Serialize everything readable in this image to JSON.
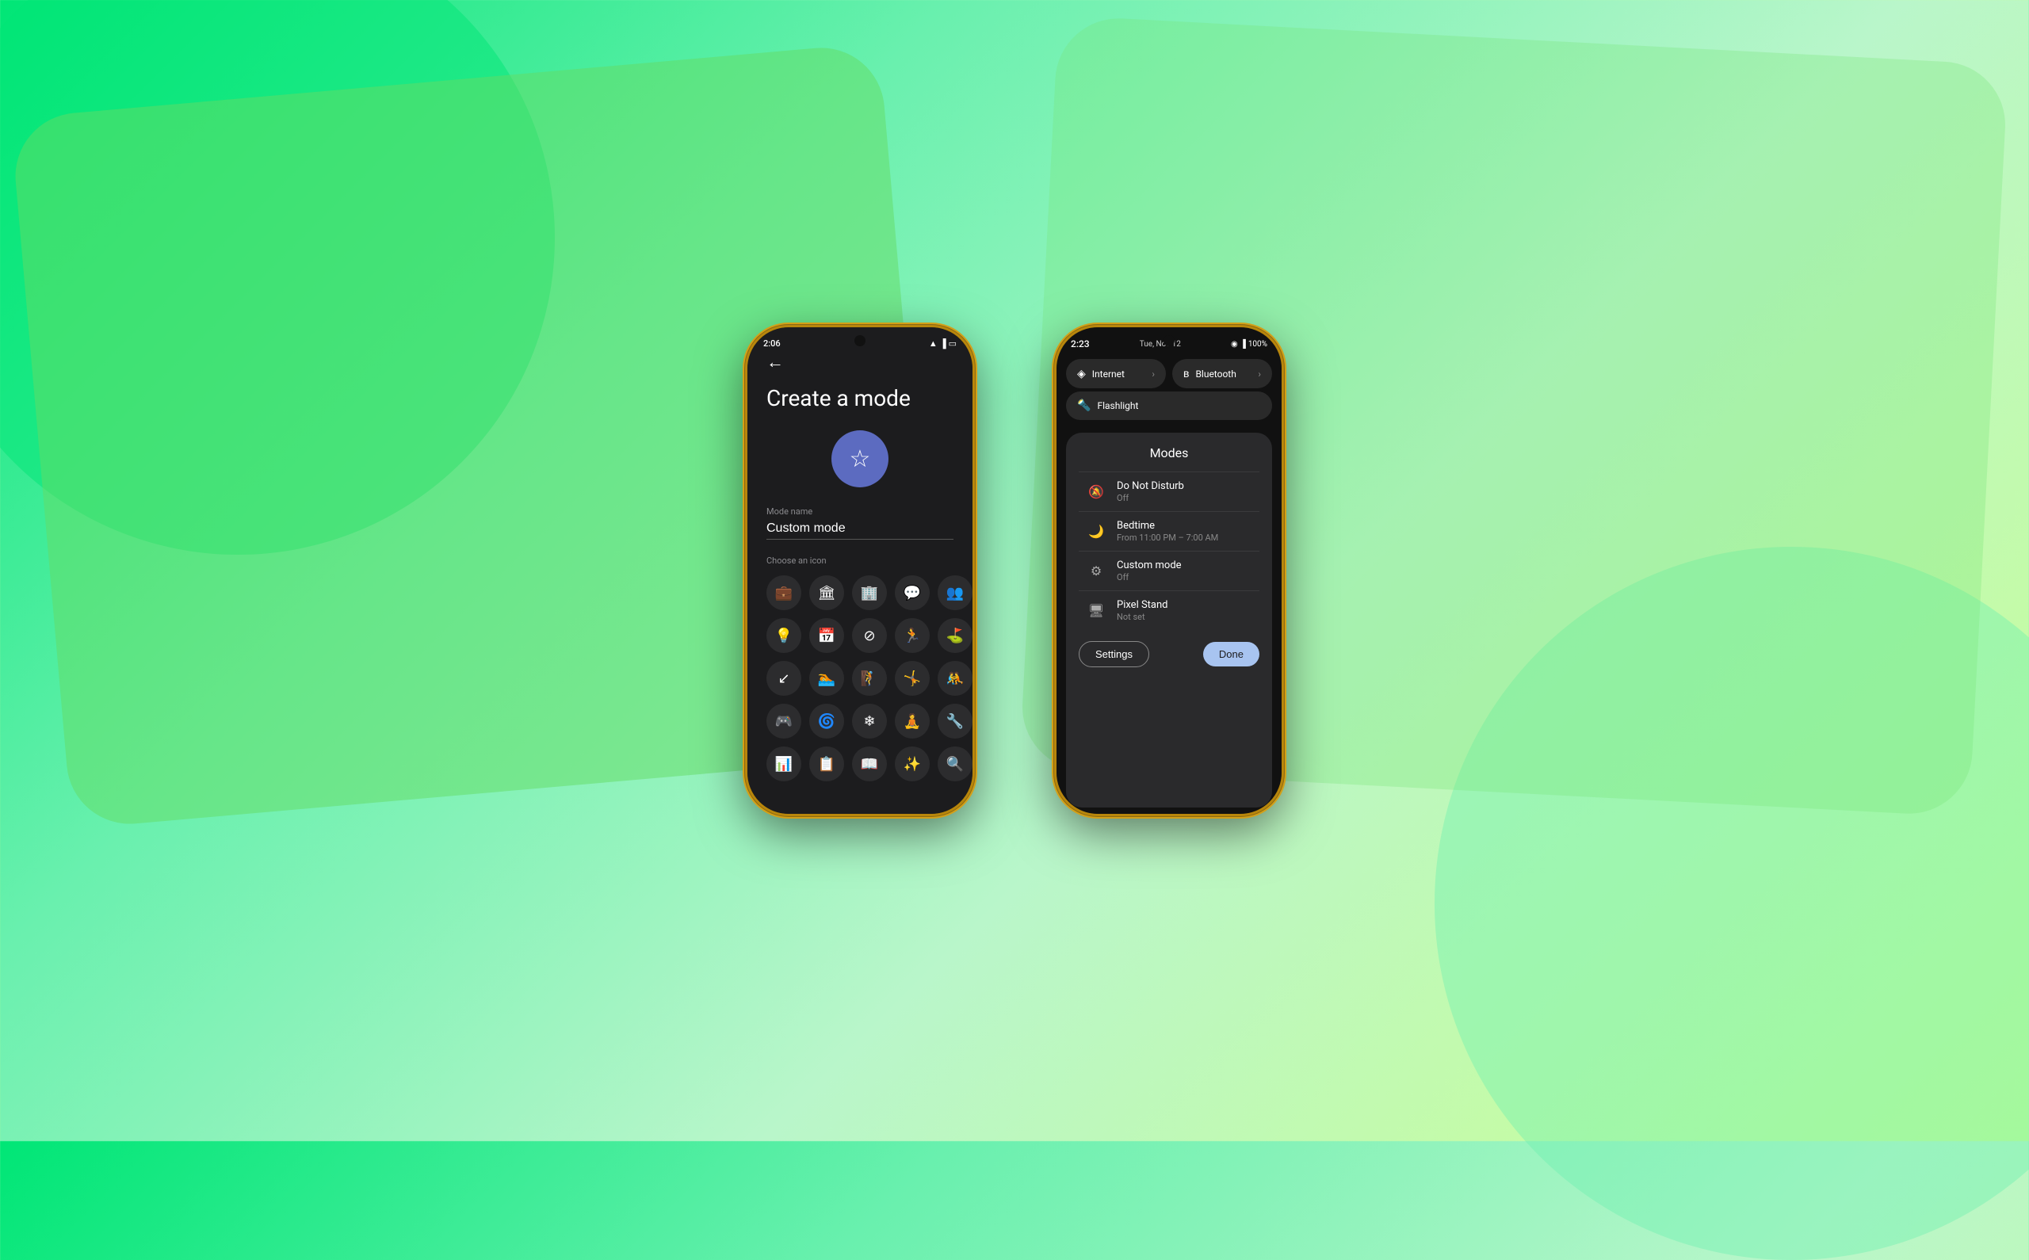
{
  "background": {
    "color1": "#00e676",
    "color2": "#69f0ae"
  },
  "phone1": {
    "statusBar": {
      "time": "2:06",
      "icons": [
        "wifi",
        "signal",
        "battery"
      ]
    },
    "title": "Create a mode",
    "iconLabel": "Mode name",
    "modeNameValue": "Custom mode",
    "modeNamePlaceholder": "Custom mode",
    "chooseIconLabel": "Choose an icon",
    "icons": [
      "💼",
      "🏛",
      "🏢",
      "💬",
      "👥",
      "💡",
      "📅",
      "⊘",
      "🏃",
      "⛳",
      "↙",
      "🏊",
      "🧗",
      "🤸",
      "🤼",
      "🎮",
      "🌀",
      "❄",
      "🧘",
      "🔧",
      "📊",
      "📋",
      "📖",
      "✨",
      "🔍"
    ]
  },
  "phone2": {
    "statusBar": {
      "time": "2:23",
      "date": "Tue, Nov 12",
      "icons": [
        "wifi",
        "signal",
        "battery100"
      ]
    },
    "quickTiles": [
      {
        "icon": "wifi",
        "label": "Internet",
        "hasArrow": true
      },
      {
        "icon": "bluetooth",
        "label": "Bluetooth",
        "hasArrow": true
      }
    ],
    "flashlightTile": {
      "icon": "flashlight",
      "label": "Flashlight"
    },
    "modesPanel": {
      "title": "Modes",
      "items": [
        {
          "icon": "🔕",
          "name": "Do Not Disturb",
          "status": "Off"
        },
        {
          "icon": "🌙",
          "name": "Bedtime",
          "status": "From 11:00 PM – 7:00 AM"
        },
        {
          "icon": "⚙",
          "name": "Custom mode",
          "status": "Off"
        },
        {
          "icon": "🖥",
          "name": "Pixel Stand",
          "status": "Not set"
        }
      ],
      "settingsButton": "Settings",
      "doneButton": "Done"
    }
  }
}
